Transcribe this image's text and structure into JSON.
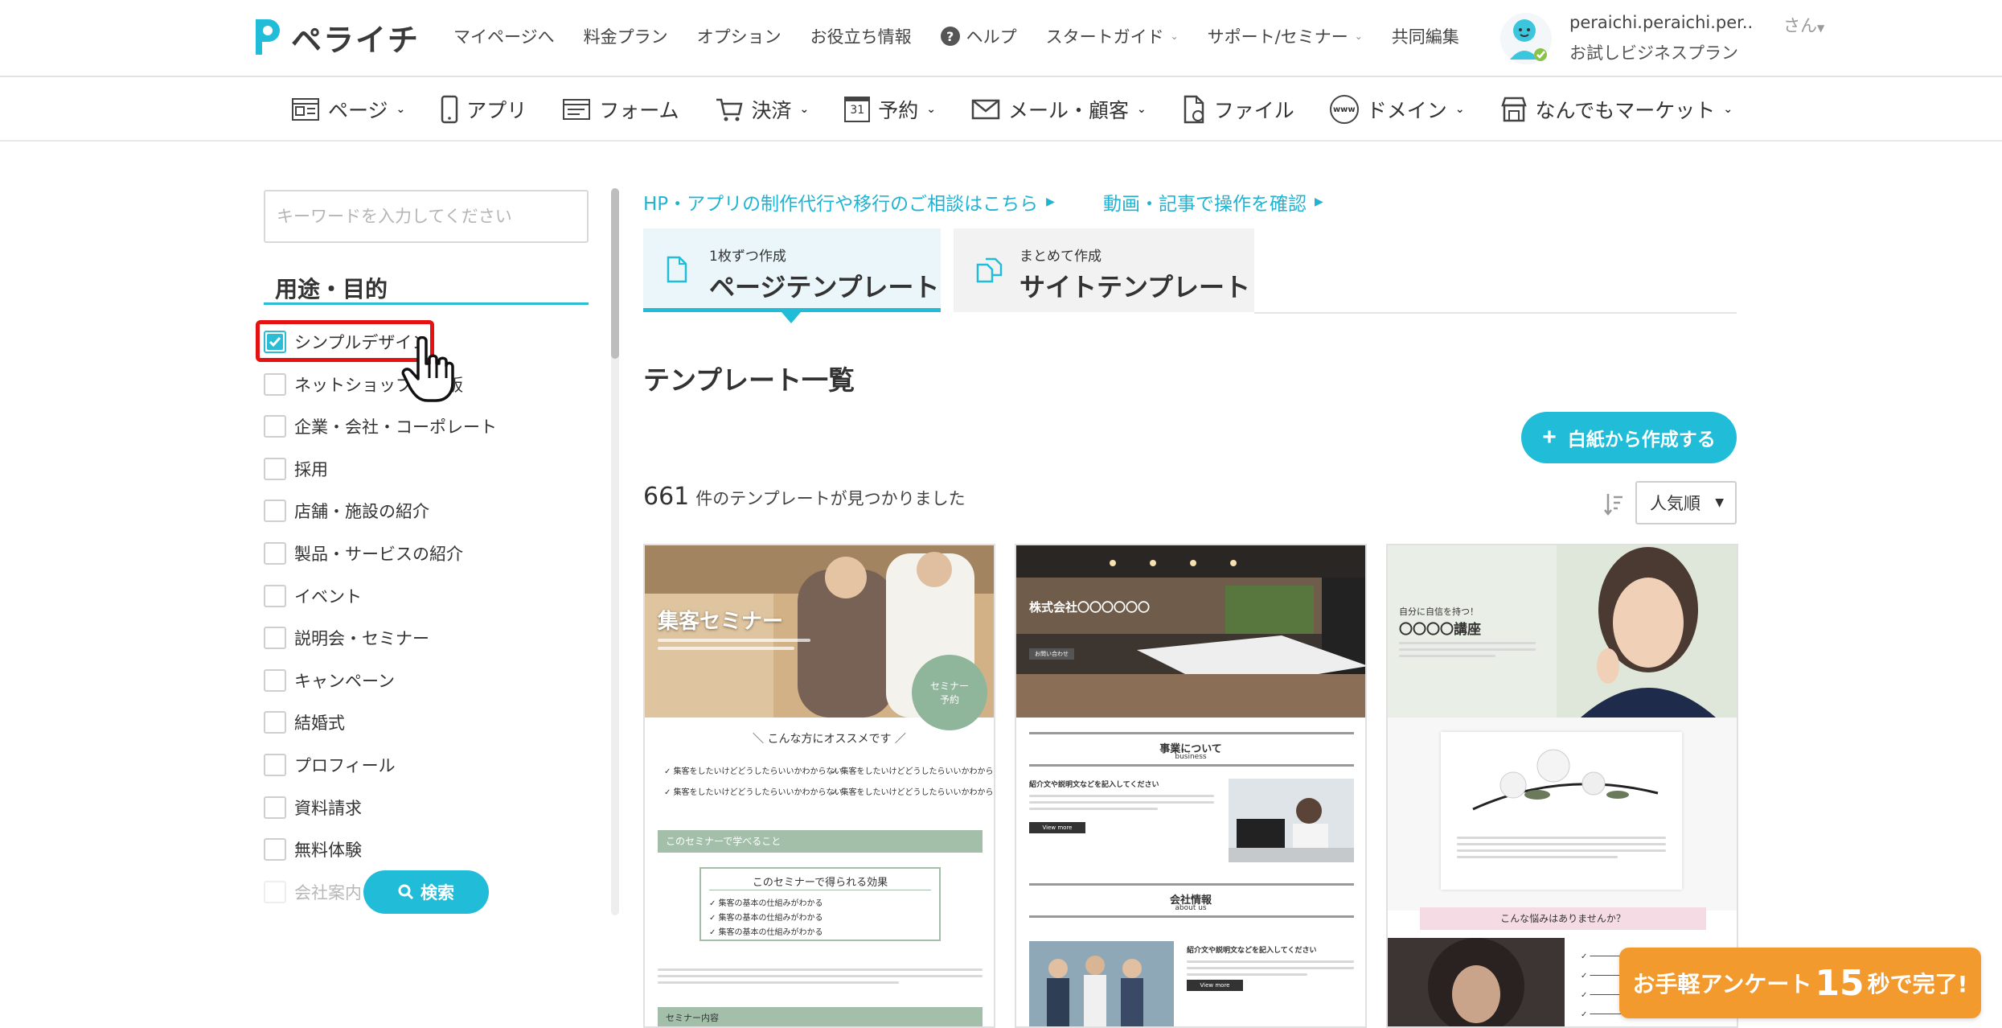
{
  "app": {
    "logo_text": "ペライチ",
    "brand_color": "#21bcd8"
  },
  "topnav": {
    "items": [
      {
        "label": "マイページへ",
        "dropdown": false
      },
      {
        "label": "料金プラン",
        "dropdown": false
      },
      {
        "label": "オプション",
        "dropdown": false
      },
      {
        "label": "お役立ち情報",
        "dropdown": false
      },
      {
        "label": "ヘルプ",
        "dropdown": false,
        "icon": "help-circle-icon"
      },
      {
        "label": "スタートガイド",
        "dropdown": true
      },
      {
        "label": "サポート/セミナー",
        "dropdown": true
      },
      {
        "label": "共同編集",
        "dropdown": false
      }
    ],
    "help_glyph": "?",
    "user": {
      "name": "peraichi.peraichi.per..",
      "plan": "お試しビジネスプラン",
      "suffix": "さん"
    }
  },
  "menubar": {
    "items": [
      {
        "label": "ページ",
        "icon": "page-icon",
        "dropdown": true
      },
      {
        "label": "アプリ",
        "icon": "smartphone-icon",
        "dropdown": false
      },
      {
        "label": "フォーム",
        "icon": "form-icon",
        "dropdown": false
      },
      {
        "label": "決済",
        "icon": "cart-icon",
        "dropdown": true
      },
      {
        "label": "予約",
        "icon": "calendar-icon",
        "dropdown": true,
        "icon_text": "31"
      },
      {
        "label": "メール・顧客",
        "icon": "mail-icon",
        "dropdown": true
      },
      {
        "label": "ファイル",
        "icon": "file-icon",
        "dropdown": false
      },
      {
        "label": "ドメイン",
        "icon": "globe-icon",
        "dropdown": true,
        "icon_text": "www"
      },
      {
        "label": "なんでもマーケット",
        "icon": "store-icon",
        "dropdown": true
      }
    ]
  },
  "sidebar": {
    "keyword_placeholder": "キーワードを入力してください",
    "section_title": "用途・目的",
    "filters": [
      {
        "label": "シンプルデザイン",
        "checked": true
      },
      {
        "label": "ネットショップ・通販",
        "checked": false
      },
      {
        "label": "企業・会社・コーポレート",
        "checked": false
      },
      {
        "label": "採用",
        "checked": false
      },
      {
        "label": "店舗・施設の紹介",
        "checked": false
      },
      {
        "label": "製品・サービスの紹介",
        "checked": false
      },
      {
        "label": "イベント",
        "checked": false
      },
      {
        "label": "説明会・セミナー",
        "checked": false
      },
      {
        "label": "キャンペーン",
        "checked": false
      },
      {
        "label": "結婚式",
        "checked": false
      },
      {
        "label": "プロフィール",
        "checked": false
      },
      {
        "label": "資料請求",
        "checked": false
      },
      {
        "label": "無料体験",
        "checked": false
      },
      {
        "label": "会社案内",
        "checked": false
      }
    ],
    "search_button": "検索"
  },
  "main": {
    "links": [
      {
        "label": "HP・アプリの制作代行や移行のご相談はこちら"
      },
      {
        "label": "動画・記事で操作を確認"
      }
    ],
    "tabs": [
      {
        "sub": "1枚ずつ作成",
        "label": "ページテンプレート",
        "active": true
      },
      {
        "sub": "まとめて作成",
        "label": "サイトテンプレート",
        "active": false
      }
    ],
    "list_title": "テンプレート一覧",
    "blank_button": "白紙から作成する",
    "result_count": "661",
    "result_text": "件のテンプレートが見つかりました",
    "sort_value": "人気順"
  },
  "cards": [
    {
      "hero_title": "集客セミナー",
      "badge": "セミナー\n予約",
      "section_heading": "＼ こんな方にオススメです ／",
      "checks": [
        "集客をしたいけどどうしたらいいかわからない",
        "集客をしたいけどどうしたらいいかわからない",
        "集客をしたいけどどうしたらいいかわからない",
        "集客をしたいけどどうしたらいいかわからない"
      ],
      "band_label": "このセミナーで学べること",
      "box_title": "このセミナーで得られる効果",
      "box_items": [
        "集客の基本の仕組みがわかる",
        "集客の基本の仕組みがわかる",
        "集客の基本の仕組みがわかる"
      ],
      "band2_label": "セミナー内容"
    },
    {
      "hero_title": "株式会社〇〇〇〇〇〇",
      "hero_button": "お問い合わせ",
      "sec1_title": "事業について",
      "sec1_sub": "business",
      "sec1_lead": "紹介文や説明文などを記入してください",
      "btn_label": "View more",
      "sec2_title": "会社情報",
      "sec2_sub": "about us",
      "sec2_lead": "紹介文や説明文などを記入してください",
      "btn2_label": "View more"
    },
    {
      "hero_kicker": "自分に自信を持つ！",
      "hero_title": "〇〇〇〇講座",
      "ribbon": "こんな悩みはありませんか？"
    }
  ],
  "survey_banner": {
    "pre": "お手軽アンケート",
    "num": "15",
    "post": "秒で完了!",
    "color": "#f29a2e"
  }
}
